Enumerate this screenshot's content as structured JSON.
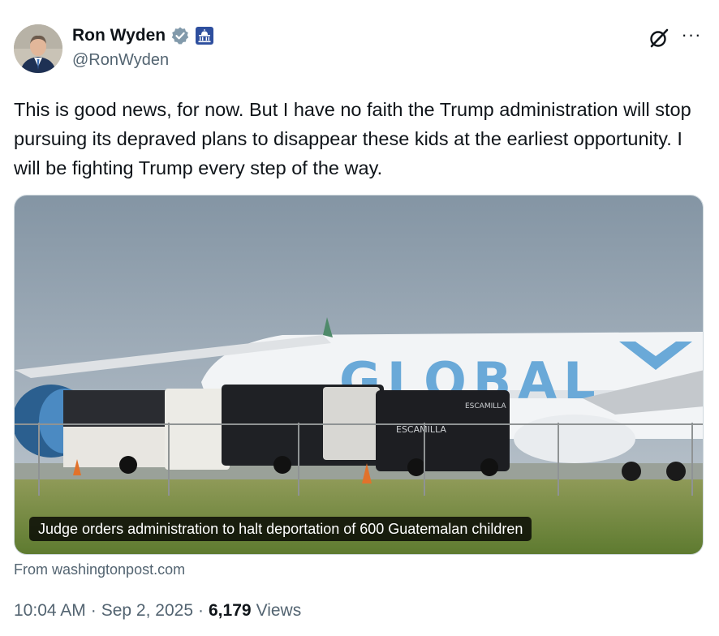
{
  "author": {
    "display_name": "Ron Wyden",
    "handle": "@RonWyden",
    "verified": true,
    "government_badge": true,
    "colors": {
      "verified": "#829aab",
      "gov_badge": "#2e4f9e"
    }
  },
  "icons": {
    "grok": "grok-icon",
    "more": "more-icon",
    "verified": "verified-badge-icon",
    "gov": "capitol-badge-icon"
  },
  "more_glyph": "···",
  "tweet": {
    "text": "This is good news, for now. But I have no faith the Trump administration will stop pursuing its depraved plans to disappear these kids at the earliest opportunity. I will be fighting Trump every step of the way."
  },
  "link_card": {
    "headline": "Judge orders administration to halt deportation of 600 Guatemalan children",
    "source": "From washingtonpost.com",
    "image_lettering": [
      "GLOBAL",
      "ESCAMILLA",
      "ESCAMILLA"
    ]
  },
  "meta": {
    "time": "10:04 AM",
    "date": "Sep 2, 2025",
    "views_count": "6,179",
    "views_label": "Views",
    "separator": "·"
  }
}
